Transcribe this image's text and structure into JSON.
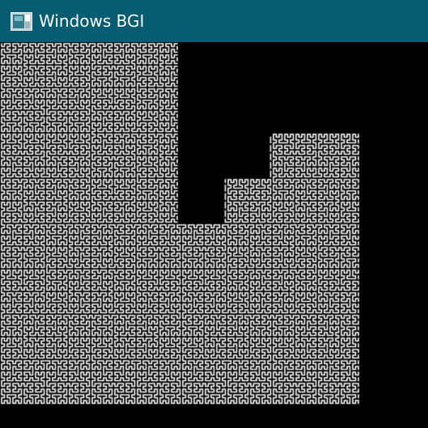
{
  "window": {
    "title": "Windows BGI",
    "icon": "bgi-window-icon",
    "titlebar_color": "#065d72",
    "title_color": "#ffffff"
  },
  "canvas": {
    "background_color": "#000000",
    "curve_color": "#ffffff",
    "pattern": "hilbert-curve-maze"
  }
}
